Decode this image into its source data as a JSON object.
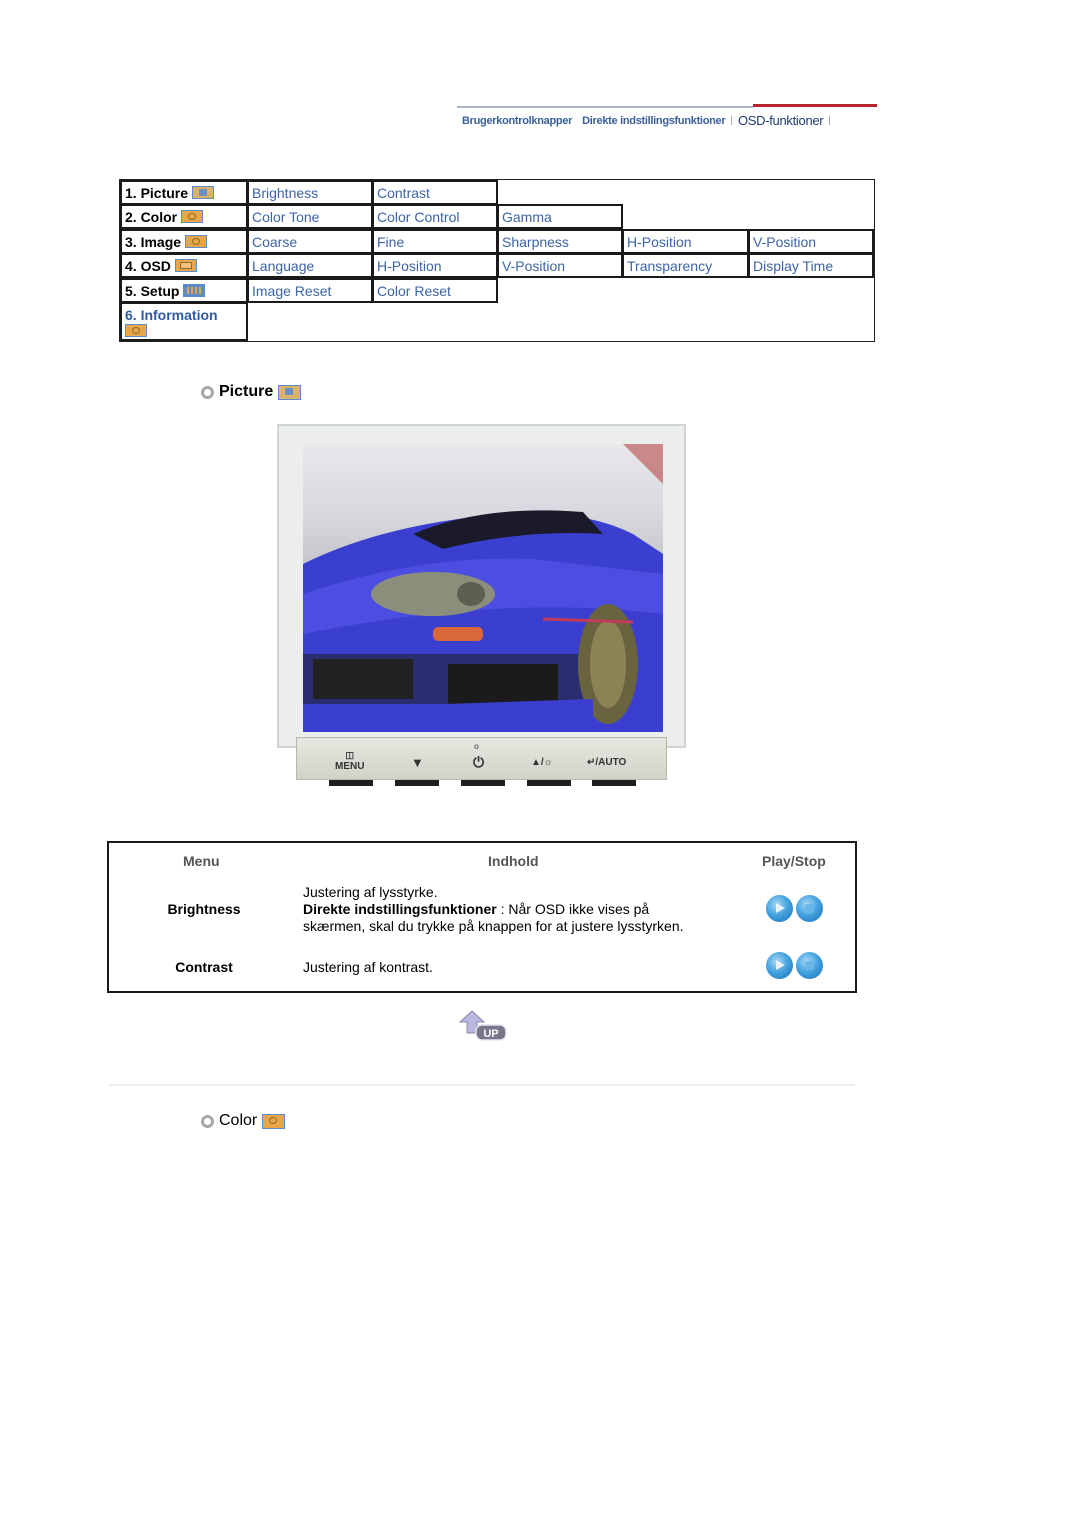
{
  "topnav": {
    "items": [
      "Brugerkontrolknapper",
      "Direkte indstillingsfunktioner",
      "OSD-funktioner"
    ],
    "active_index": 2,
    "accent_color": "#b8222e"
  },
  "menu_grid": {
    "rows": [
      {
        "label": "1. Picture",
        "icon": "picture-icon",
        "items": [
          "Brightness",
          "Contrast"
        ]
      },
      {
        "label": "2. Color",
        "icon": "color-icon",
        "items": [
          "Color Tone",
          "Color Control",
          "Gamma"
        ]
      },
      {
        "label": "3. Image",
        "icon": "image-icon",
        "items": [
          "Coarse",
          "Fine",
          "Sharpness",
          "H-Position",
          "V-Position"
        ]
      },
      {
        "label": "4. OSD",
        "icon": "osd-icon",
        "items": [
          "Language",
          "H-Position",
          "V-Position",
          "Transparency",
          "Display Time"
        ]
      },
      {
        "label": "5. Setup",
        "icon": "setup-icon",
        "items": [
          "Image Reset",
          "Color Reset"
        ]
      },
      {
        "label": "6. Information",
        "icon": "information-icon",
        "items": []
      }
    ]
  },
  "sections": {
    "picture": {
      "title": "Picture",
      "icon": "picture-icon"
    },
    "color": {
      "title": "Color",
      "icon": "color-icon"
    }
  },
  "monitor": {
    "buttons": [
      "MENU",
      "▼",
      "⏻",
      "▲/☼",
      "↵/AUTO"
    ]
  },
  "info_table": {
    "headers": {
      "menu": "Menu",
      "content": "Indhold",
      "playstop": "Play/Stop"
    },
    "rows": [
      {
        "menu": "Brightness",
        "line1": "Justering af lysstyrke.",
        "bold": "Direkte indstillingsfunktioner",
        "line2": " : Når OSD ikke vises på",
        "line3": "skærmen, skal du trykke på knappen for at justere lysstyrken."
      },
      {
        "menu": "Contrast",
        "line1": "Justering af kontrast."
      }
    ]
  },
  "up_button": {
    "label": "UP"
  }
}
